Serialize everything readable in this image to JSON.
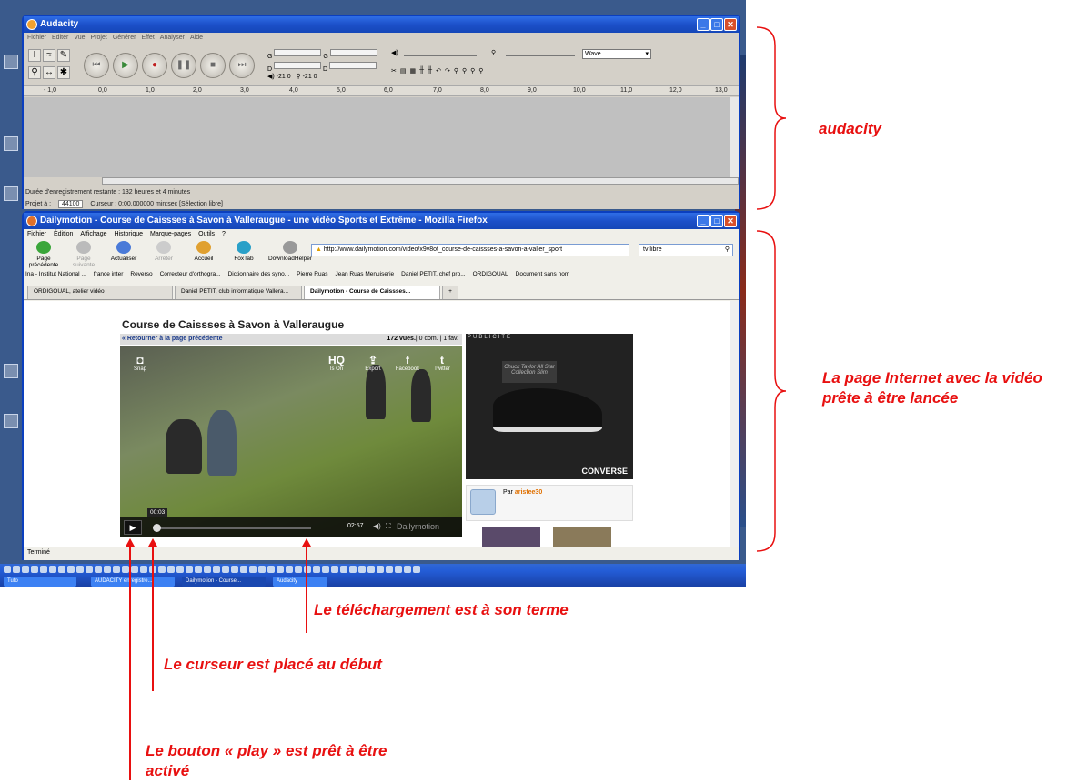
{
  "audacity": {
    "title": "Audacity",
    "menu": [
      "Fichier",
      "Editer",
      "Vue",
      "Projet",
      "Générer",
      "Effet",
      "Analyser",
      "Aide"
    ],
    "meter_l": "G",
    "meter_r": "D",
    "meter_val1": "-21",
    "meter_val2": "0",
    "wave_option": "Wave",
    "ruler": [
      "- 1,0",
      "0,0",
      "1,0",
      "2,0",
      "3,0",
      "4,0",
      "5,0",
      "6,0",
      "7,0",
      "8,0",
      "9,0",
      "10,0",
      "11,0",
      "12,0",
      "13,0"
    ],
    "remaining": "Durée d'enregistrement restante : 132 heures et 4 minutes",
    "project_rate_label": "Projet à :",
    "project_rate": "44100",
    "cursor": "Curseur : 0:00,000000 min:sec  [Sélection libre]"
  },
  "firefox": {
    "title": "Dailymotion - Course de Caissses à Savon à Valleraugue - une vidéo Sports et Extrême - Mozilla Firefox",
    "menu": [
      "Fichier",
      "Édition",
      "Affichage",
      "Historique",
      "Marque-pages",
      "Outils",
      "?"
    ],
    "nav": [
      "Page précédente",
      "Page suivante",
      "Actualiser",
      "Arrêter",
      "Accueil",
      "FoxTab",
      "DownloadHelper"
    ],
    "url": "http://www.dailymotion.com/video/x9v8ot_course-de-caissses-a-savon-a-valler_sport",
    "search": "tv libre",
    "bookmarks": [
      "Ina - Institut National ...",
      "france inter",
      "Reverso",
      "Correcteur d'orthogra...",
      "Dictionnaire des syno...",
      "Pierre Ruas",
      "Jean Ruas Menuiserie",
      "Daniel PETIT, chef pro...",
      "ORDIGOUAL",
      "Document sans nom"
    ],
    "tabs": [
      "ORDIGOUAL, atelier vidéo",
      "Daniel PETIT, club informatique Vallera...",
      "Dailymotion - Course de Caissses..."
    ],
    "status": "Terminé"
  },
  "video_page": {
    "title": "Course de Caissses à Savon à Valleraugue",
    "back": "« Retourner à la page précédente",
    "views": "172 vues.",
    "stats": "| 0 com. | 1 fav.",
    "icons": [
      {
        "label": "Snap",
        "glyph": "◘"
      },
      {
        "label": "Is On",
        "glyph": "HQ"
      },
      {
        "label": "Export",
        "glyph": "⇪"
      },
      {
        "label": "Facebook",
        "glyph": "f"
      },
      {
        "label": "Twitter",
        "glyph": "t"
      }
    ],
    "time_tip": "00:03",
    "duration": "02:57",
    "brand": "Dailymotion",
    "ad_label": "PUBLICITÉ",
    "ad_tag": "Chuck Taylor All Star Collection Slim",
    "ad_brand": "CONVERSE",
    "author_prefix": "Par",
    "author": "aristee30"
  },
  "taskbar": {
    "tasks": [
      "Tuto",
      "AUDACITY enregistre...",
      "Dailymotion - Course...",
      "Audacity"
    ]
  },
  "annotations": {
    "audacity": "audacity",
    "page": "La page Internet avec la vidéo prête à être lancée",
    "download": "Le téléchargement est à son terme",
    "cursor": "Le curseur est placé au début",
    "play": "Le bouton « play » est prêt à être activé"
  },
  "colors": {
    "annotation": "#e81010",
    "xp_title": "#1c50c9",
    "author_link": "#e07000"
  }
}
